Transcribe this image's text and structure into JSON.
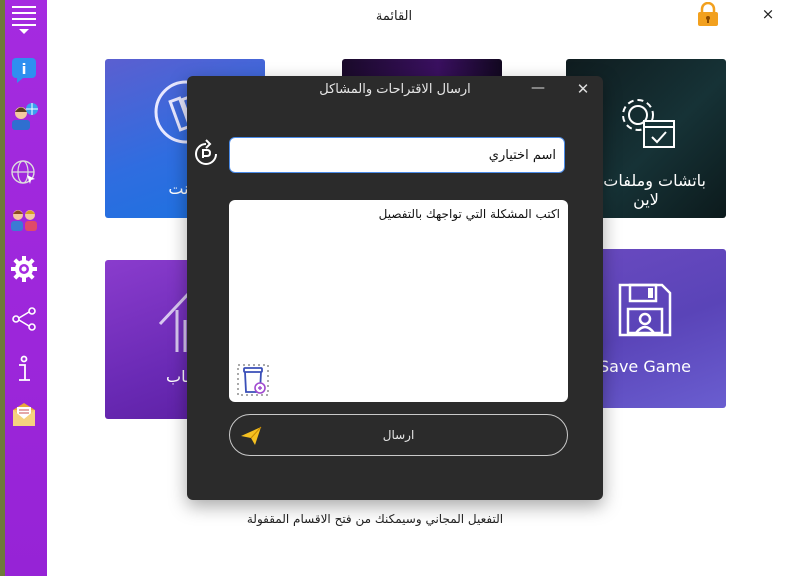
{
  "window": {
    "title": "القائمة",
    "close_icon": "×"
  },
  "sidebar": {
    "items": [
      {
        "name": "menu-icon"
      },
      {
        "name": "info-chat-icon"
      },
      {
        "name": "user-globe-icon"
      },
      {
        "name": "globe-cursor-icon"
      },
      {
        "name": "users-icon"
      },
      {
        "name": "settings-gear-icon"
      },
      {
        "name": "share-icon"
      },
      {
        "name": "info-icon"
      },
      {
        "name": "mail-icon"
      }
    ]
  },
  "tiles": {
    "torrent": {
      "label": "تورنت"
    },
    "patches": {
      "label_line1": "باتشات وملفات او",
      "label_line2": "لاين"
    },
    "games": {
      "label": "العاب"
    },
    "savegame": {
      "label": "Save Game"
    }
  },
  "footer": {
    "text": "التفعيل المجاني وسيمكنك من فتح الاقسام المقفولة"
  },
  "dialog": {
    "title": "ارسال الاقتراحات والمشاكل",
    "min_icon": "—",
    "close_icon": "✕",
    "name_value": "اسم اختياري",
    "problem_value": "اكتب المشكلة التي تواجهك بالتفصيل",
    "send_label": "ارسال"
  },
  "colors": {
    "sidebar": "#a52be0",
    "dialog_bg": "#2b2b2b",
    "input_border": "#4a8be8",
    "lock": "#f2a01e"
  }
}
